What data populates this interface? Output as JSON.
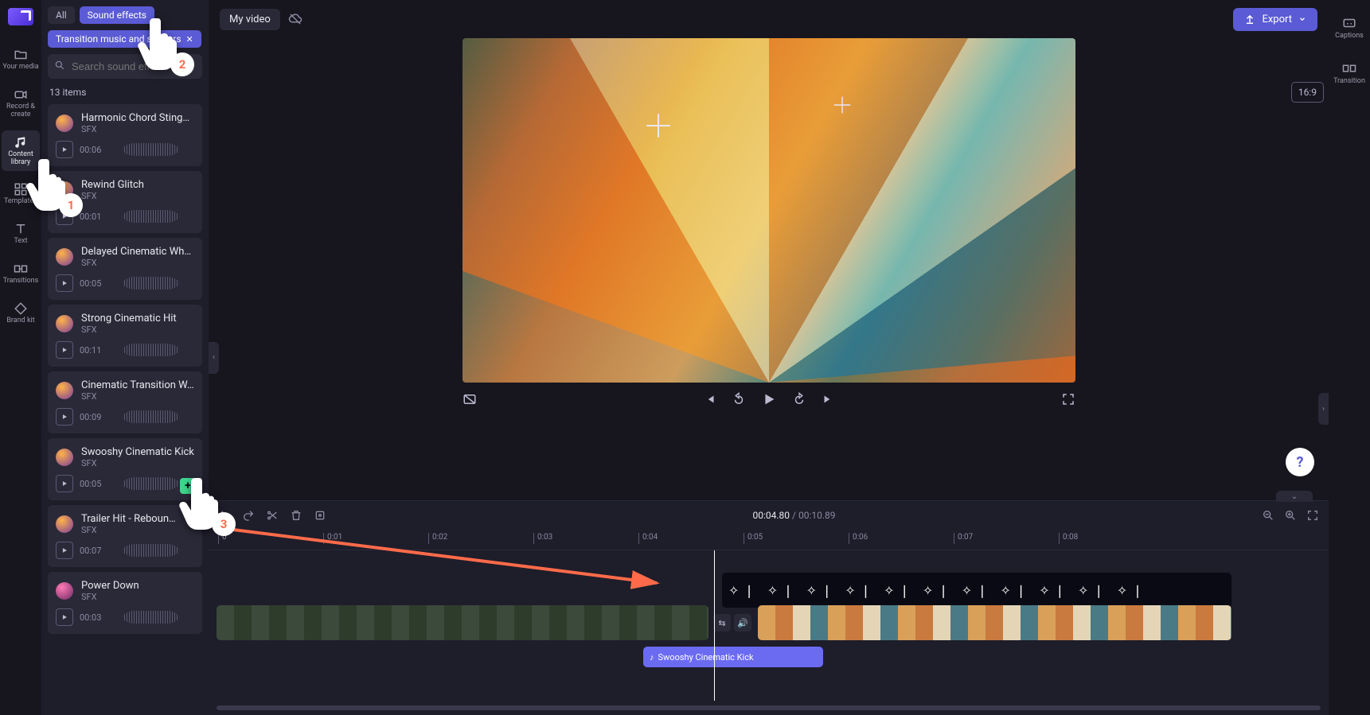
{
  "app": {
    "title": "My video",
    "export_label": "Export",
    "aspect_label": "16:9"
  },
  "left_rail": {
    "items": [
      {
        "label": "Your media"
      },
      {
        "label": "Record & create"
      },
      {
        "label": "Content library",
        "active": true
      },
      {
        "label": "Templates"
      },
      {
        "label": "Text"
      },
      {
        "label": "Transitions"
      },
      {
        "label": "Brand kit"
      }
    ]
  },
  "right_rail": {
    "items": [
      {
        "label": "Captions"
      },
      {
        "label": "Transition"
      }
    ]
  },
  "library": {
    "tabs": {
      "all": "All",
      "sound_effects": "Sound effects"
    },
    "chip": "Transition music and stingers",
    "search_placeholder": "Search sound effects",
    "count_label": "13 items",
    "items": [
      {
        "name": "Harmonic Chord Sting…",
        "kind": "SFX",
        "duration": "00:06"
      },
      {
        "name": "Rewind Glitch",
        "kind": "SFX",
        "duration": "00:01"
      },
      {
        "name": "Delayed Cinematic Wh…",
        "kind": "SFX",
        "duration": "00:05"
      },
      {
        "name": "Strong Cinematic Hit",
        "kind": "SFX",
        "duration": "00:11"
      },
      {
        "name": "Cinematic Transition W…",
        "kind": "SFX",
        "duration": "00:09"
      },
      {
        "name": "Swooshy Cinematic Kick",
        "kind": "SFX",
        "duration": "00:05",
        "showadd": true
      },
      {
        "name": "Trailer Hit - Reboun…",
        "kind": "SFX",
        "duration": "00:07"
      },
      {
        "name": "Power Down",
        "kind": "SFX",
        "duration": "00:03",
        "alt": true
      }
    ]
  },
  "timeline": {
    "current": "00:04.80",
    "total": "00:10.89",
    "ticks": [
      "0",
      "0:01",
      "0:02",
      "0:03",
      "0:04",
      "0:05",
      "0:06",
      "0:07",
      "0:08"
    ],
    "audio_clip_label": "Swooshy Cinematic Kick"
  },
  "annotations": {
    "p1": "1",
    "p2": "2",
    "p3": "3"
  }
}
